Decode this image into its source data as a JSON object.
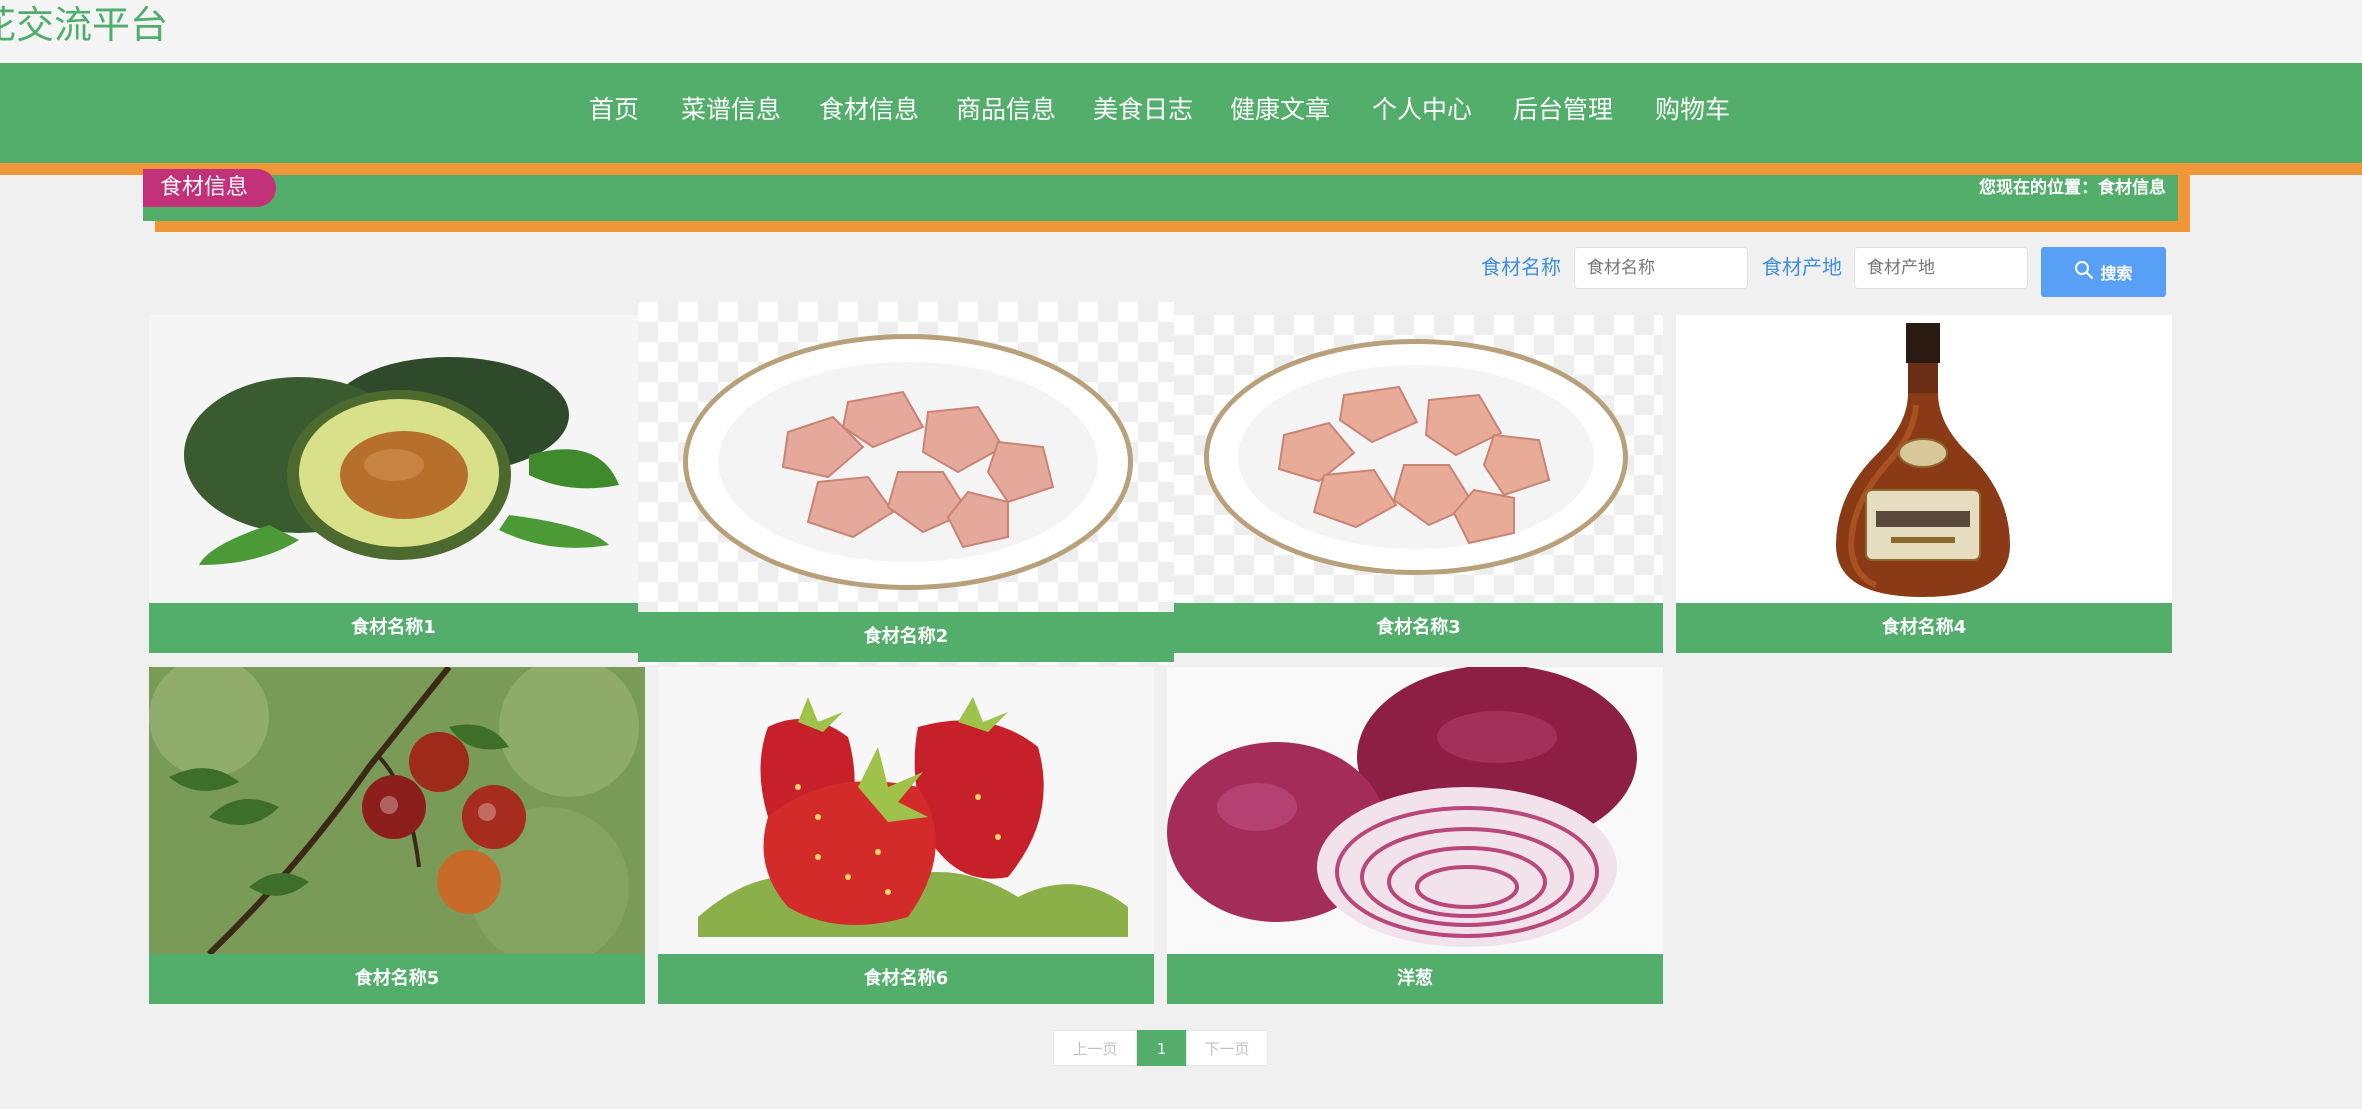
{
  "site": {
    "title": "花交流平台"
  },
  "nav": {
    "items": [
      {
        "label": "首页"
      },
      {
        "label": "菜谱信息"
      },
      {
        "label": "食材信息"
      },
      {
        "label": "商品信息"
      },
      {
        "label": "美食日志"
      },
      {
        "label": "健康文章"
      },
      {
        "label": "个人中心"
      },
      {
        "label": "后台管理"
      },
      {
        "label": "购物车"
      }
    ]
  },
  "breadcrumb": {
    "section_title": "食材信息",
    "location_text": "您现在的位置：食材信息"
  },
  "search": {
    "name_label": "食材名称",
    "name_placeholder": "食材名称",
    "name_value": "",
    "origin_label": "食材产地",
    "origin_placeholder": "食材产地",
    "origin_value": "",
    "button_label": "搜索",
    "button_icon": "search-icon"
  },
  "cards": [
    {
      "name": "食材名称1",
      "image": "avocado"
    },
    {
      "name": "食材名称2",
      "image": "raw-chicken-plate"
    },
    {
      "name": "食材名称3",
      "image": "raw-chicken-plate"
    },
    {
      "name": "食材名称4",
      "image": "cognac-bottle"
    },
    {
      "name": "食材名称5",
      "image": "plums-on-branch"
    },
    {
      "name": "食材名称6",
      "image": "strawberries"
    },
    {
      "name": "洋葱",
      "image": "red-onions"
    }
  ],
  "pagination": {
    "prev_label": "上一页",
    "current_page": "1",
    "next_label": "下一页"
  },
  "colors": {
    "primary_green": "#53ad6b",
    "accent_orange": "#ee9638",
    "badge_magenta": "#c2317a",
    "search_blue": "#57a0f6",
    "label_blue": "#3f8fe0"
  }
}
